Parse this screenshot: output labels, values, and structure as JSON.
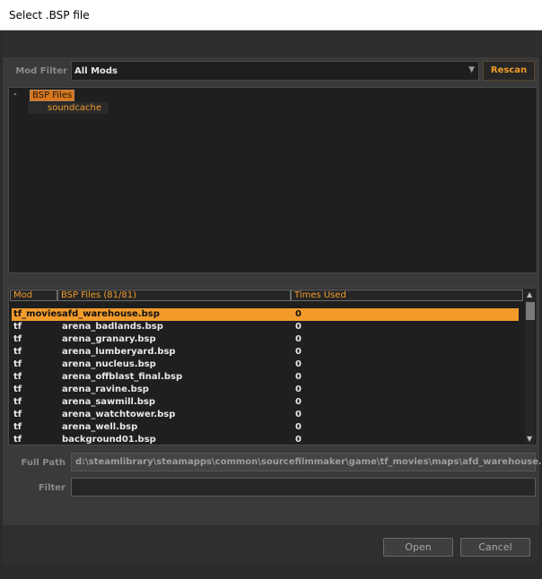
{
  "window": {
    "title": "Select .BSP file"
  },
  "mod_filter": {
    "label": "Mod Filter",
    "value": "All Mods",
    "rescan_label": "Rescan"
  },
  "tree": {
    "expander": "-",
    "root": "BSP Files",
    "child": "soundcache"
  },
  "list": {
    "headers": {
      "mod": "Mod",
      "file": "BSP Files (81/81)",
      "times": "Times Used"
    },
    "rows": [
      {
        "mod": "tf_movies",
        "file": "afd_warehouse.bsp",
        "times": "0"
      },
      {
        "mod": "tf",
        "file": "arena_badlands.bsp",
        "times": "0"
      },
      {
        "mod": "tf",
        "file": "arena_granary.bsp",
        "times": "0"
      },
      {
        "mod": "tf",
        "file": "arena_lumberyard.bsp",
        "times": "0"
      },
      {
        "mod": "tf",
        "file": "arena_nucleus.bsp",
        "times": "0"
      },
      {
        "mod": "tf",
        "file": "arena_offblast_final.bsp",
        "times": "0"
      },
      {
        "mod": "tf",
        "file": "arena_ravine.bsp",
        "times": "0"
      },
      {
        "mod": "tf",
        "file": "arena_sawmill.bsp",
        "times": "0"
      },
      {
        "mod": "tf",
        "file": "arena_watchtower.bsp",
        "times": "0"
      },
      {
        "mod": "tf",
        "file": "arena_well.bsp",
        "times": "0"
      },
      {
        "mod": "tf",
        "file": "background01.bsp",
        "times": "0"
      }
    ]
  },
  "full_path": {
    "label": "Full Path",
    "value": "d:\\steamlibrary\\steamapps\\common\\sourcefilmmaker\\game\\tf_movies\\maps\\afd_warehouse.bsp"
  },
  "filter": {
    "label": "Filter",
    "value": ""
  },
  "buttons": {
    "open": "Open",
    "cancel": "Cancel"
  },
  "colors": {
    "accent": "#f29b2a",
    "selection": "#d9761a",
    "background": "#3a3a3a"
  },
  "icons": {
    "combo": "chevron-down-icon",
    "scroll_up": "arrow-up-icon",
    "scroll_down": "arrow-down-icon"
  }
}
